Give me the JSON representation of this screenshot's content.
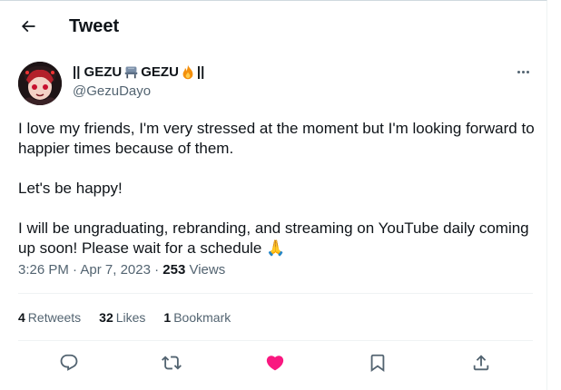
{
  "header": {
    "title": "Tweet"
  },
  "author": {
    "name_left": "|| GEZU",
    "name_right": "GEZU",
    "name_end": "||",
    "handle": "@GezuDayo"
  },
  "tweet": {
    "paragraph1": "I love my friends, I'm very stressed at the moment but I'm looking forward to happier times because of them.",
    "paragraph2": "Let's be happy!",
    "paragraph3": "I will be ungraduating, rebranding, and streaming on YouTube daily coming up soon! Please wait for a schedule",
    "paragraph3_emoji": "🙏"
  },
  "meta": {
    "time": "3:26 PM",
    "sep1": " · ",
    "date": "Apr 7, 2023",
    "sep2": " · ",
    "views_count": "253",
    "views_label": " Views"
  },
  "stats": {
    "retweets_count": "4",
    "retweets_label": "Retweets",
    "likes_count": "32",
    "likes_label": "Likes",
    "bookmarks_count": "1",
    "bookmarks_label": "Bookmark"
  },
  "colors": {
    "text": "#0f1419",
    "secondary": "#536471",
    "like_active": "#f91880",
    "divider": "#eff3f4"
  },
  "icons": [
    "back-arrow-icon",
    "more-icon",
    "reply-icon",
    "retweet-icon",
    "like-icon",
    "bookmark-icon",
    "share-icon"
  ]
}
